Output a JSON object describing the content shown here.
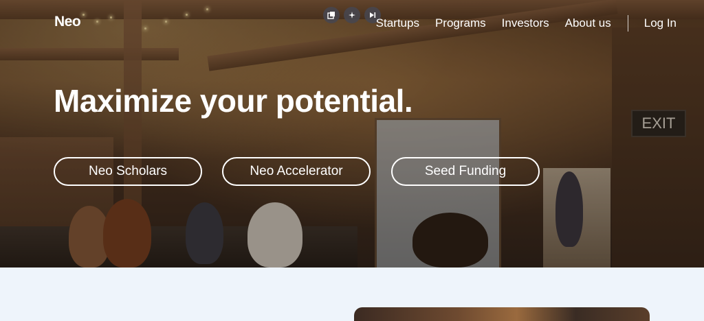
{
  "brand": {
    "logo_text": "Neo"
  },
  "nav": {
    "items": [
      {
        "label": "Startups"
      },
      {
        "label": "Programs"
      },
      {
        "label": "Investors"
      },
      {
        "label": "About us"
      }
    ],
    "login_label": "Log In"
  },
  "overlay_toolbar": {
    "icons": [
      "picture-in-picture-icon",
      "sparkles-icon",
      "skip-forward-icon"
    ]
  },
  "hero": {
    "headline": "Maximize your potential.",
    "buttons": [
      {
        "label": "Neo Scholars"
      },
      {
        "label": "Neo Accelerator"
      },
      {
        "label": "Seed Funding"
      }
    ],
    "background_sign_text": "EXIT"
  },
  "colors": {
    "page_background": "#eef4fb",
    "text_on_hero": "#ffffff"
  }
}
